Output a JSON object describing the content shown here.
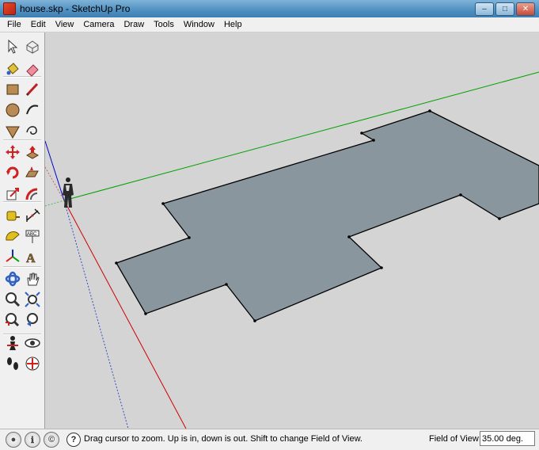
{
  "window": {
    "title": "house.skp - SketchUp Pro"
  },
  "menu": [
    "File",
    "Edit",
    "View",
    "Camera",
    "Draw",
    "Tools",
    "Window",
    "Help"
  ],
  "tools": [
    {
      "name": "select-tool-icon"
    },
    {
      "name": "make-component-icon"
    },
    {
      "name": "paint-bucket-icon"
    },
    {
      "name": "eraser-icon"
    },
    {
      "name": "rectangle-tool-icon"
    },
    {
      "name": "line-tool-icon"
    },
    {
      "name": "circle-tool-icon"
    },
    {
      "name": "arc-tool-icon"
    },
    {
      "name": "polygon-tool-icon"
    },
    {
      "name": "freehand-tool-icon"
    },
    {
      "name": "move-tool-icon"
    },
    {
      "name": "push-pull-icon"
    },
    {
      "name": "rotate-tool-icon"
    },
    {
      "name": "follow-me-icon"
    },
    {
      "name": "scale-tool-icon"
    },
    {
      "name": "offset-tool-icon"
    },
    {
      "name": "tape-measure-icon"
    },
    {
      "name": "dimension-tool-icon"
    },
    {
      "name": "protractor-icon"
    },
    {
      "name": "text-tool-icon"
    },
    {
      "name": "axes-tool-icon"
    },
    {
      "name": "3d-text-icon"
    },
    {
      "name": "orbit-tool-icon"
    },
    {
      "name": "pan-tool-icon"
    },
    {
      "name": "zoom-tool-icon"
    },
    {
      "name": "zoom-window-icon"
    },
    {
      "name": "zoom-extents-icon"
    },
    {
      "name": "previous-view-icon"
    },
    {
      "name": "position-camera-icon"
    },
    {
      "name": "look-around-icon"
    },
    {
      "name": "walk-tool-icon"
    },
    {
      "name": "section-plane-icon"
    }
  ],
  "status": {
    "message": "Drag cursor to zoom.  Up is in, down is out. Shift to change Field of View.",
    "vcb_label": "Field of View",
    "vcb_value": "35.00 deg."
  },
  "colors": {
    "face": "#8a969d",
    "red_axis": "#cc0000",
    "green_axis": "#00a000",
    "blue_axis": "#0000cc",
    "background": "#d4d4d4"
  }
}
